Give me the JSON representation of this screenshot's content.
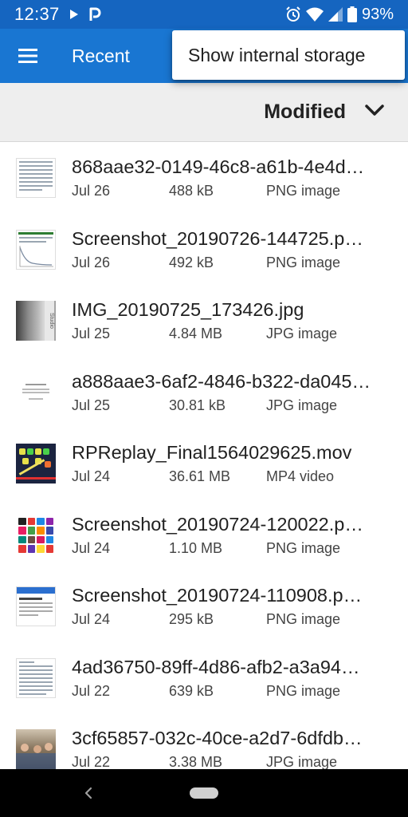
{
  "status_bar": {
    "time": "12:37",
    "battery_percent": "93%",
    "icons": [
      "play-icon",
      "p-icon",
      "alarm-icon",
      "wifi-icon",
      "signal-icon",
      "battery-icon"
    ]
  },
  "app_bar": {
    "title": "Recent",
    "menu_icon": "hamburger-menu-icon",
    "background": "#1976d2"
  },
  "popup_menu": {
    "item": "Show internal storage"
  },
  "sort_bar": {
    "label": "Modified",
    "icon": "chevron-down-icon"
  },
  "files": [
    {
      "name": "868aae32-0149-46c8-a61b-4e4d…",
      "date": "Jul 26",
      "size": "488 kB",
      "type": "PNG image",
      "thumb": "document"
    },
    {
      "name": "Screenshot_20190726-144725.p…",
      "date": "Jul 26",
      "size": "492 kB",
      "type": "PNG image",
      "thumb": "document-chart"
    },
    {
      "name": "IMG_20190725_173426.jpg",
      "date": "Jul 25",
      "size": "4.84 MB",
      "type": "JPG image",
      "thumb": "photo"
    },
    {
      "name": "a888aae3-6af2-4846-b322-da045…",
      "date": "Jul 25",
      "size": "30.81 kB",
      "type": "JPG image",
      "thumb": "text-card"
    },
    {
      "name": "RPReplay_Final1564029625.mov",
      "date": "Jul 24",
      "size": "36.61 MB",
      "type": "MP4 video",
      "thumb": "game"
    },
    {
      "name": "Screenshot_20190724-120022.p…",
      "date": "Jul 24",
      "size": "1.10 MB",
      "type": "PNG image",
      "thumb": "icon-grid"
    },
    {
      "name": "Screenshot_20190724-110908.p…",
      "date": "Jul 24",
      "size": "295 kB",
      "type": "PNG image",
      "thumb": "webpage"
    },
    {
      "name": "4ad36750-89ff-4d86-afb2-a3a94…",
      "date": "Jul 22",
      "size": "639 kB",
      "type": "PNG image",
      "thumb": "document"
    },
    {
      "name": "3cf65857-032c-40ce-a2d7-6dfdb…",
      "date": "Jul 22",
      "size": "3.38 MB",
      "type": "JPG image",
      "thumb": "people-photo"
    }
  ],
  "nav_bar": {
    "icons": [
      "back-icon",
      "home-pill-icon"
    ]
  }
}
